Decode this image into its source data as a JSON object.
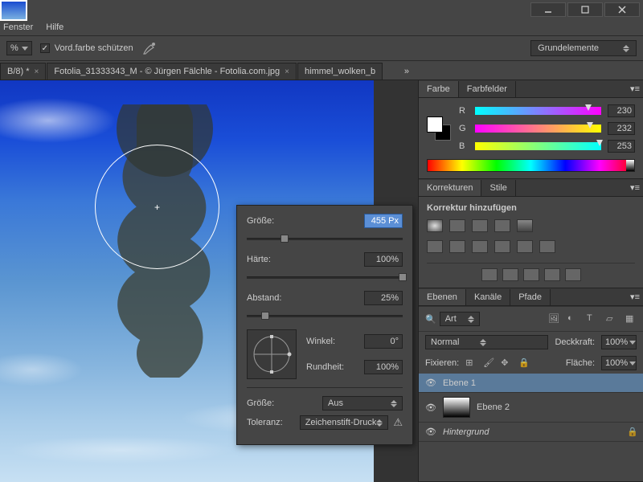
{
  "menu": {
    "fenster": "Fenster",
    "hilfe": "Hilfe"
  },
  "optionsBar": {
    "protectFg": "Vord.farbe schützen"
  },
  "workspace": {
    "selected": "Grundelemente"
  },
  "tabs": {
    "t1": "B/8) *",
    "t2": "Fotolia_31333343_M - © Jürgen Fälchle - Fotolia.com.jpg",
    "t3": "himmel_wolken_b"
  },
  "brushPopup": {
    "sizeLabel": "Größe:",
    "sizeValue": "455 Px",
    "hardnessLabel": "Härte:",
    "hardnessValue": "100%",
    "spacingLabel": "Abstand:",
    "spacingValue": "25%",
    "angleLabel": "Winkel:",
    "angleValue": "0°",
    "roundnessLabel": "Rundheit:",
    "roundnessValue": "100%",
    "sizeDynLabel": "Größe:",
    "sizeDynValue": "Aus",
    "tolLabel": "Toleranz:",
    "tolValue": "Zeichenstift-Druck"
  },
  "panels": {
    "farbe": "Farbe",
    "farbfelder": "Farbfelder",
    "korrekturen": "Korrekturen",
    "stile": "Stile",
    "addCorrection": "Korrektur hinzufügen",
    "ebenen": "Ebenen",
    "kanaele": "Kanäle",
    "pfade": "Pfade"
  },
  "rgb": {
    "r": "R",
    "g": "G",
    "b": "B",
    "rV": "230",
    "gV": "232",
    "bV": "253"
  },
  "layers": {
    "filter": "Art",
    "blend": "Normal",
    "opacityLabel": "Deckkraft:",
    "opacityValue": "100%",
    "fixLabel": "Fixieren:",
    "fillLabel": "Fläche:",
    "fillValue": "100%",
    "l1": "Ebene 1",
    "l2": "Ebene 2",
    "l3": "Hintergrund"
  }
}
